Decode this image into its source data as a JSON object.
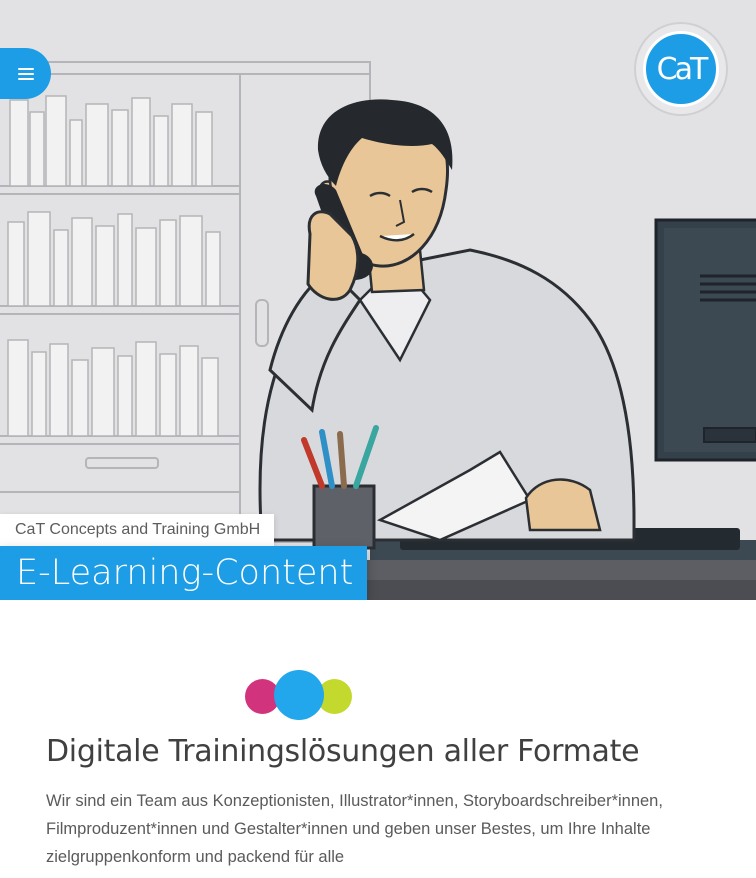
{
  "header": {
    "menu_icon": "hamburger-menu-icon",
    "logo_text": "CaT"
  },
  "hero": {
    "company": "CaT Concepts and Training GmbH",
    "title": "E-Learning-Content",
    "illustration": "man-on-phone-at-desk"
  },
  "main": {
    "dots_colors": [
      "#d2337d",
      "#22a6ec",
      "#c4d92d"
    ],
    "heading": "Digitale Trainingslösungen aller Formate",
    "intro": "Wir sind ein Team aus Konzeptionisten, Illustrator*innen, Storyboardschreiber*innen, Filmproduzent*innen und Gestalter*innen und geben unser Bestes, um Ihre Inhalte zielgruppenkonform und packend für alle"
  },
  "colors": {
    "accent": "#1c9de6"
  }
}
